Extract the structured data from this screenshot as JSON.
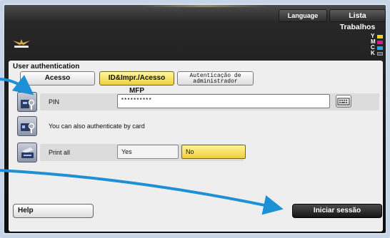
{
  "topbar": {
    "language_label": "Language",
    "jobs_label": "Lista Trabalhos"
  },
  "toner": [
    {
      "letter": "Y",
      "color": "#f7d31c"
    },
    {
      "letter": "M",
      "color": "#e0148c"
    },
    {
      "letter": "C",
      "color": "#1fa9e1"
    },
    {
      "letter": "K",
      "color": "#333333"
    }
  ],
  "auth": {
    "title": "User authentication",
    "tabs": [
      {
        "label": "Acesso"
      },
      {
        "label": "ID&Impr./Acesso MFP",
        "selected": true
      },
      {
        "label": "Autenticação de administrador"
      }
    ],
    "pin_label": "PIN",
    "pin_value": "**********",
    "card_text": "You can also authenticate by card",
    "print_all_label": "Print all",
    "print_all_options": [
      "Yes",
      "No"
    ],
    "print_all_selected": "No"
  },
  "footer": {
    "help_label": "Help",
    "login_label": "Iniciar sessão"
  },
  "colors": {
    "selected_accent": "#f0cf3a",
    "arrow_blue": "#1e90d6"
  }
}
